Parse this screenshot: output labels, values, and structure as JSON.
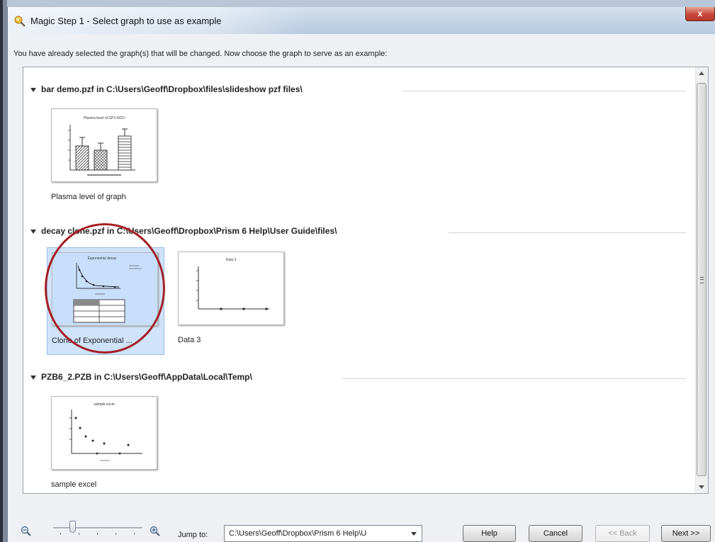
{
  "window": {
    "title": "Magic Step 1 - Select graph to use as example",
    "close_label": "x"
  },
  "instruction": "You have already selected the graph(s) that will be changed. Now choose the graph to serve as an example:",
  "groups": [
    {
      "header": "bar demo.pzf in C:\\Users\\Geoff\\Dropbox\\files\\slideshow pzf files\\",
      "items": [
        {
          "label": "Plasma level of graph",
          "thumb_title": "Plasma level of GP1-NCD",
          "selected": false
        }
      ]
    },
    {
      "header": "decay clone.pzf in C:\\Users\\Geoff\\Dropbox\\Prism 6 Help\\User Guide\\files\\",
      "items": [
        {
          "label": "Clone of Exponential ...",
          "thumb_title": "Exponential decay",
          "selected": true
        },
        {
          "label": "Data 3",
          "thumb_title": "Data 3",
          "selected": false
        }
      ]
    },
    {
      "header": "PZB6_2.PZB in C:\\Users\\Geoff\\AppData\\Local\\Temp\\",
      "items": [
        {
          "label": "sample excel",
          "thumb_title": "sample excel",
          "selected": false
        }
      ]
    }
  ],
  "footer": {
    "zoom_level": 0.2,
    "jump_label": "Jump to:",
    "jump_value": "C:\\Users\\Geoff\\Dropbox\\Prism 6 Help\\U",
    "help_label": "Help",
    "cancel_label": "Cancel",
    "back_label": "<< Back",
    "next_label": "Next >>"
  },
  "colors": {
    "selection": "#cfe3fb",
    "highlight_circle": "#a51f24",
    "close_button": "#c8473a"
  }
}
